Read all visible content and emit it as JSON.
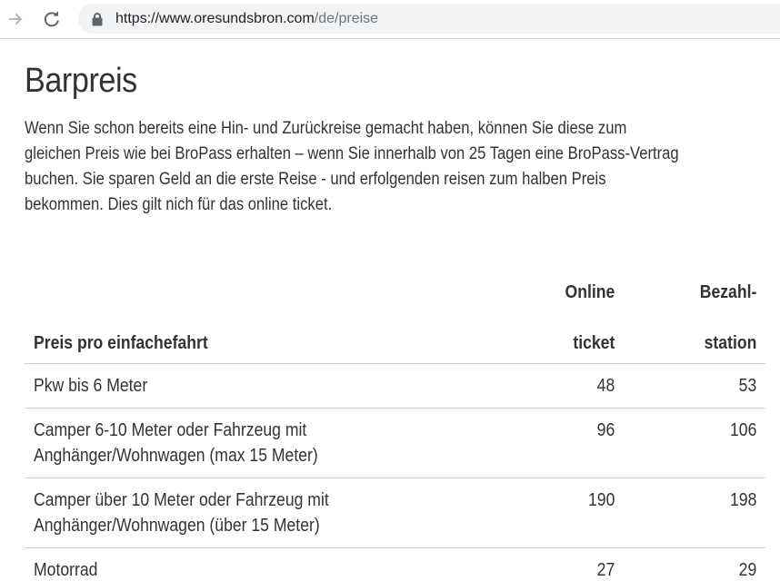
{
  "browser": {
    "url_host": "https://www.oresundsbron.com",
    "url_path": "/de/preise",
    "icons": [
      "forward-arrow-icon",
      "reload-icon",
      "lock-icon"
    ]
  },
  "page": {
    "title": "Barpreis",
    "intro_lines": [
      "Wenn Sie schon bereits eine Hin- und Zurückreise gemacht haben, können Sie diese zum",
      "gleichen Preis wie bei BroPass erhalten – wenn Sie innerhalb von 25 Tagen eine BroPass-Vertrag",
      "buchen. Sie sparen Geld an die erste Reise - und erfolgenden reisen zum halben Preis",
      "bekommen. Dies gilt nich für das online ticket."
    ]
  },
  "table": {
    "header": {
      "description": "Preis pro einfachefahrt",
      "online_line1": "Online",
      "online_line2": "ticket",
      "station_line1": "Bezahl-",
      "station_line2": "station"
    },
    "rows": [
      {
        "line1": "Pkw bis 6 Meter",
        "line2": "",
        "online": "48",
        "station": "53"
      },
      {
        "line1": "Camper 6-10 Meter oder Fahrzeug mit",
        "line2": "Anghänger/Wohnwagen (max 15 Meter)",
        "online": "96",
        "station": "106"
      },
      {
        "line1": "Camper über 10 Meter oder Fahrzeug mit",
        "line2": "Anghänger/Wohnwagen (über 15 Meter)",
        "online": "190",
        "station": "198"
      },
      {
        "line1": "Motorrad",
        "line2": "",
        "online": "27",
        "station": "29"
      }
    ]
  },
  "colors": {
    "text": "#333333",
    "url_host": "#202124",
    "url_path": "#70757a",
    "omnibox_bg": "#f1f3f4",
    "divider": "#cccccc"
  }
}
